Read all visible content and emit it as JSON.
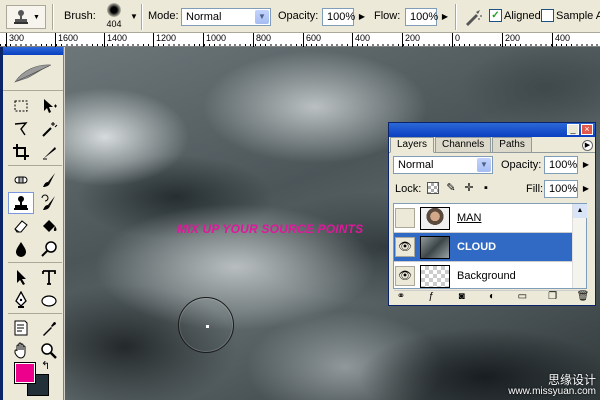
{
  "options_bar": {
    "tool_preset_icon": "clone-stamp-icon",
    "brush_label": "Brush:",
    "brush_size": "404",
    "mode_label": "Mode:",
    "mode_value": "Normal",
    "opacity_label": "Opacity:",
    "opacity_value": "100%",
    "flow_label": "Flow:",
    "flow_value": "100%",
    "airbrush_icon": "airbrush-icon",
    "aligned_label": "Aligned",
    "aligned_checked": true,
    "sample_all_label": "Sample Al",
    "sample_all_checked": false
  },
  "ruler": {
    "ticks": [
      "300",
      "1600",
      "1400",
      "1200",
      "1000",
      "800",
      "600",
      "400",
      "200",
      "0",
      "200",
      "400"
    ]
  },
  "toolbox": {
    "tools": [
      "marquee-icon",
      "move-icon",
      "lasso-icon",
      "magic-wand-icon",
      "crop-icon",
      "slice-icon",
      "healing-brush-icon",
      "brush-icon",
      "clone-stamp-icon",
      "history-brush-icon",
      "eraser-icon",
      "paint-bucket-icon",
      "blur-icon",
      "dodge-icon",
      "path-selection-icon",
      "type-icon",
      "pen-icon",
      "shape-icon",
      "notes-icon",
      "eyedropper-icon",
      "hand-icon",
      "zoom-icon"
    ],
    "active_tool": "clone-stamp-icon",
    "foreground_color": "#ec008c",
    "background_color": "#22303a"
  },
  "canvas": {
    "headline": "MIX UP YOUR SOURCE POINTS",
    "headline_color": "#e0179c",
    "watermark_line1": "思缘设计",
    "watermark_line2": "www.missyuan.com"
  },
  "layers_panel": {
    "tabs": [
      "Layers",
      "Channels",
      "Paths"
    ],
    "active_tab": "Layers",
    "blend_mode": "Normal",
    "opacity_label": "Opacity:",
    "opacity_value": "100%",
    "lock_label": "Lock:",
    "fill_label": "Fill:",
    "fill_value": "100%",
    "layers": [
      {
        "name": "MAN",
        "visible": false,
        "selected": false
      },
      {
        "name": "CLOUD",
        "visible": true,
        "selected": true
      },
      {
        "name": "Background",
        "visible": true,
        "selected": false
      }
    ]
  }
}
